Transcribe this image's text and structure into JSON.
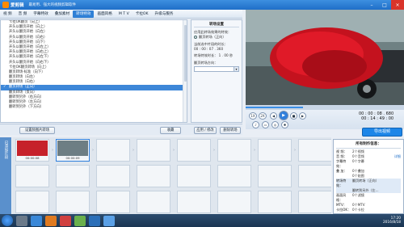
{
  "app": {
    "name": "爱剪辑",
    "slogan": "最易用、强大的视频剪辑软件"
  },
  "menu": {
    "items": [
      "视 频",
      "音 频",
      "字幕特效",
      "叠加素材",
      "转场特效",
      "画面风格",
      "M T V",
      "卡拉OK",
      "升级与服务"
    ],
    "active_index": 4
  },
  "effects_list": {
    "items": [
      "卡拉OK翻页（向上）",
      "开头以翻页开始（向上）",
      "开头以翻页开始（向左）",
      "开头以翻页开始（向右）",
      "开头以翻页开始（向下）",
      "开头以翻页开始（向左上）",
      "开头以翻页开始（向右上）",
      "开头以翻页开始（向左下）",
      "开头以翻页开始（向右下）",
      "卡拉OK翻页转场（向上）",
      "翻页转场-标准（向下）",
      "翻页转场（向左）",
      "翻页转场（向右）",
      "翻页转场（正向）",
      "翻页转场（反向）",
      "翻转到另外（右方向）",
      "翻转到另外（左方向）",
      "翻转到另外（下方向）"
    ],
    "selected_index": 13
  },
  "settings": {
    "title": "转场设置",
    "apply_label": "应用此转场效果的特效：",
    "apply_option": "翻页转场（正向）",
    "current_label": "当前选中片段的时长：",
    "current_value": "00 : 00 : 07 . 360",
    "duration_label": "转场特效时长：",
    "duration_value": "1 . 00",
    "duration_unit": "秒",
    "reverse_label": "翻页转场方向：",
    "reverse_value": ""
  },
  "actions": {
    "add_clip": "设置频图片转场",
    "remove": "收藏",
    "apply": "应用 / 修改",
    "delete": "删除转场"
  },
  "player": {
    "speed": "1X",
    "zoom": "2X",
    "time_current": "00 : 00 : 08 . 680",
    "time_total": "00 : 14 : 49 : 00",
    "progress": 0.36,
    "export_label": "导出视频"
  },
  "timeline": {
    "side_label": "已添加片段",
    "clips": [
      {
        "caption": "00:00:08",
        "has_media": true
      },
      {
        "caption": "00:00:09",
        "has_media": true,
        "selected": true
      },
      {
        "caption": "",
        "has_media": false
      },
      {
        "caption": "",
        "has_media": false
      },
      {
        "caption": "",
        "has_media": false
      },
      {
        "caption": "",
        "has_media": false
      },
      {
        "caption": "",
        "has_media": false
      },
      {
        "caption": "",
        "has_media": false
      },
      {
        "caption": "",
        "has_media": false
      }
    ]
  },
  "info": {
    "title": "所有制作信息：",
    "rows": [
      {
        "k": "视 频：",
        "v": "2个视频"
      },
      {
        "k": "音 频：",
        "v": "0个音频",
        "action": "详细"
      },
      {
        "k": "字幕特效：",
        "v": "0个字幕"
      },
      {
        "k": "叠 加：",
        "v": "0个叠加"
      },
      {
        "k": "",
        "v": "0个贴图"
      },
      {
        "k": "转场特效：",
        "v": "翻页转场（正向）"
      },
      {
        "k": "",
        "v": "翻转到另外（左..."
      },
      {
        "k": "画面风格：",
        "v": "0个滤镜"
      },
      {
        "k": "MTV：",
        "v": "0个MTV"
      },
      {
        "k": "卡拉OK：",
        "v": "0个卡拉"
      }
    ]
  },
  "taskbar": {
    "time": "17:20",
    "date": "2016/8/18"
  },
  "colors": {
    "accent": "#2f7fdc",
    "title_bg": "#1f6fc8",
    "selected_row": "#3d87d8"
  }
}
